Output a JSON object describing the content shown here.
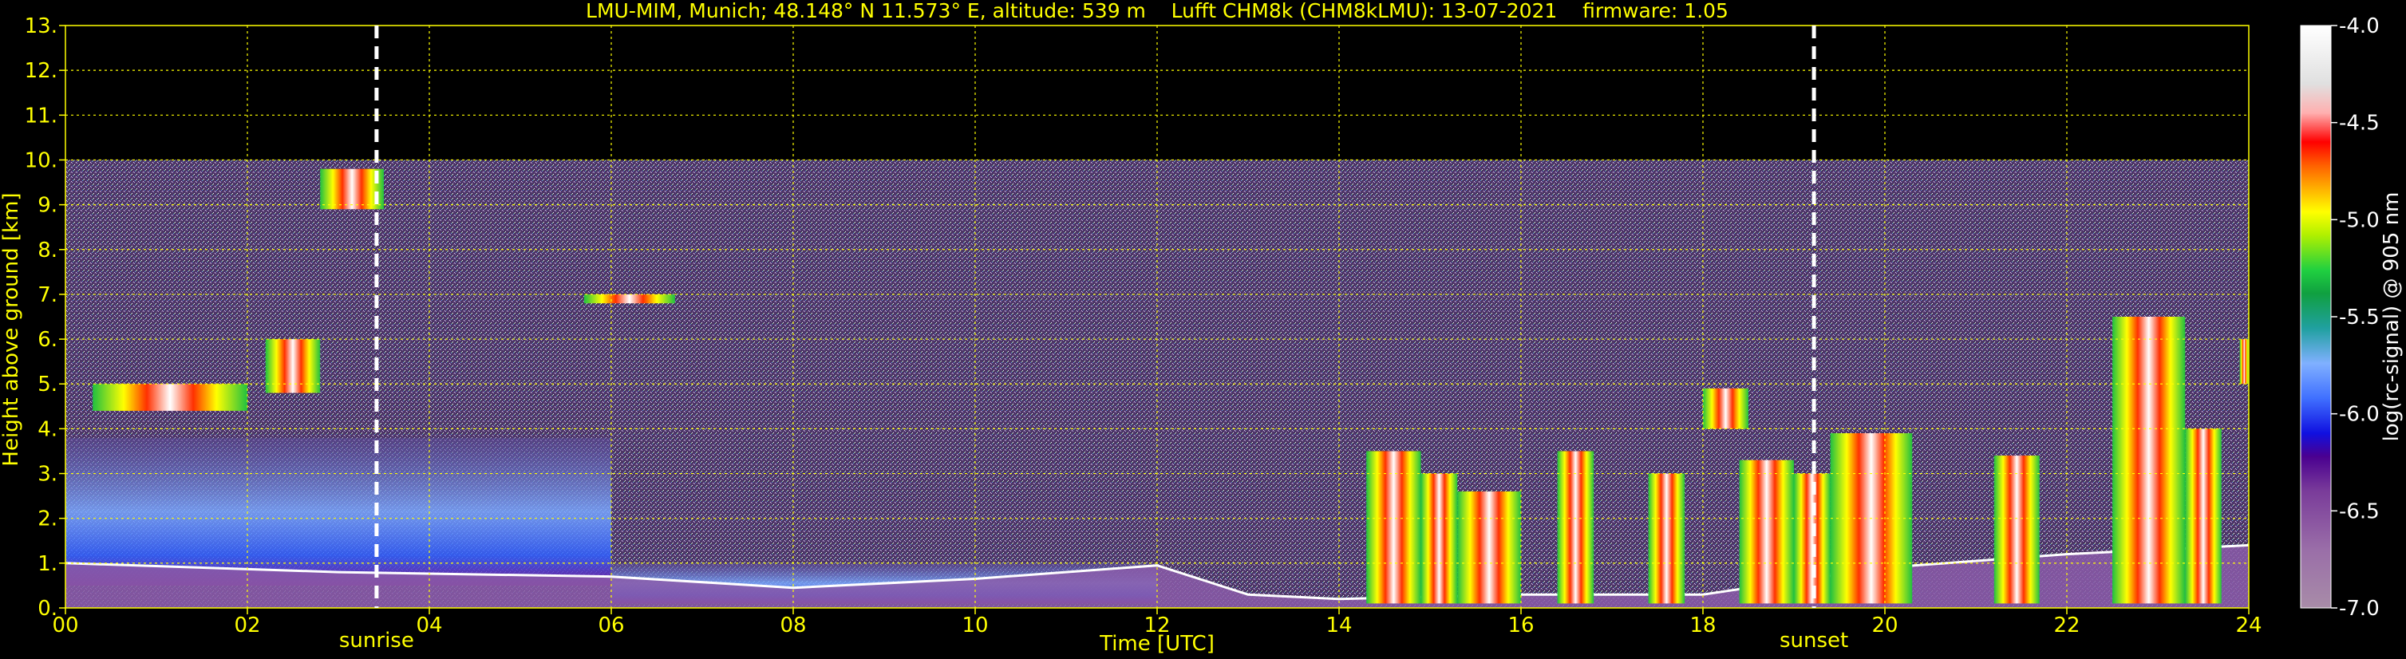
{
  "chart_data": {
    "type": "heatmap",
    "title": "LMU-MIM, Munich; 48.148° N 11.573° E, altitude: 539 m    Lufft CHM8k (CHM8kLMU): 13-07-2021    firmware: 1.05",
    "xlabel": "Time [UTC]",
    "ylabel": "Height above ground [km]",
    "xlim": [
      0,
      24
    ],
    "ylim": [
      0,
      13
    ],
    "x_ticks": [
      "00",
      "02",
      "04",
      "06",
      "08",
      "10",
      "12",
      "14",
      "16",
      "18",
      "20",
      "22",
      "24"
    ],
    "y_ticks": [
      "0.",
      "1.",
      "2.",
      "3.",
      "4.",
      "5.",
      "6.",
      "7.",
      "8.",
      "9.",
      "10.",
      "11.",
      "12.",
      "13."
    ],
    "grid": true,
    "measurement_top_km": 10,
    "annotations": [
      {
        "text": "sunrise",
        "x": 3.42
      },
      {
        "text": "sunset",
        "x": 19.22
      }
    ],
    "colorbar": {
      "label": "log(rc-signal) @ 905 nm",
      "ticks": [
        "-4.0",
        "-4.5",
        "-5.0",
        "-5.5",
        "-6.0",
        "-6.5",
        "-7.0"
      ],
      "range": [
        -7.0,
        -4.0
      ]
    },
    "boundary_layer": [
      [
        0,
        1.0
      ],
      [
        3,
        0.8
      ],
      [
        6,
        0.7
      ],
      [
        8,
        0.45
      ],
      [
        10,
        0.65
      ],
      [
        12,
        0.95
      ],
      [
        13,
        0.3
      ],
      [
        14,
        0.2
      ],
      [
        16,
        0.3
      ],
      [
        18,
        0.3
      ],
      [
        19,
        0.6
      ],
      [
        20,
        0.9
      ],
      [
        22,
        1.2
      ],
      [
        24,
        1.4
      ]
    ],
    "clouds": [
      {
        "x0": 0.3,
        "x1": 2.0,
        "y0": 4.4,
        "y1": 5.0
      },
      {
        "x0": 2.2,
        "x1": 2.8,
        "y0": 4.8,
        "y1": 6.0
      },
      {
        "x0": 2.8,
        "x1": 3.5,
        "y0": 8.9,
        "y1": 9.8
      },
      {
        "x0": 5.7,
        "x1": 6.7,
        "y0": 6.8,
        "y1": 7.0
      },
      {
        "x0": 14.3,
        "x1": 14.9,
        "y0": 0.1,
        "y1": 3.5
      },
      {
        "x0": 14.9,
        "x1": 15.3,
        "y0": 0.1,
        "y1": 3.0
      },
      {
        "x0": 15.3,
        "x1": 16.0,
        "y0": 0.1,
        "y1": 2.6
      },
      {
        "x0": 16.4,
        "x1": 16.8,
        "y0": 0.1,
        "y1": 3.5
      },
      {
        "x0": 17.4,
        "x1": 17.8,
        "y0": 0.1,
        "y1": 3.0
      },
      {
        "x0": 18.0,
        "x1": 18.5,
        "y0": 4.0,
        "y1": 4.9
      },
      {
        "x0": 18.4,
        "x1": 19.0,
        "y0": 0.1,
        "y1": 3.3
      },
      {
        "x0": 19.0,
        "x1": 19.4,
        "y0": 0.1,
        "y1": 3.0
      },
      {
        "x0": 19.4,
        "x1": 20.3,
        "y0": 0.1,
        "y1": 3.9
      },
      {
        "x0": 21.2,
        "x1": 21.7,
        "y0": 0.1,
        "y1": 3.4
      },
      {
        "x0": 22.5,
        "x1": 23.3,
        "y0": 0.1,
        "y1": 6.5
      },
      {
        "x0": 23.3,
        "x1": 23.7,
        "y0": 0.1,
        "y1": 4.0
      },
      {
        "x0": 23.9,
        "x1": 24.0,
        "y0": 5.0,
        "y1": 6.0
      }
    ],
    "aerosol_layers": [
      {
        "x0": 0,
        "x1": 6,
        "y0": 0.5,
        "y1": 3.8
      },
      {
        "x0": 6,
        "x1": 12,
        "y0": 0.1,
        "y1": 1.0
      }
    ],
    "colors": {
      "text": "#ffff00",
      "grid": "#ffff00",
      "background_noise": "#5a3d7a",
      "aerosol": "#6a8cff",
      "cloud": "#ffffff"
    }
  }
}
